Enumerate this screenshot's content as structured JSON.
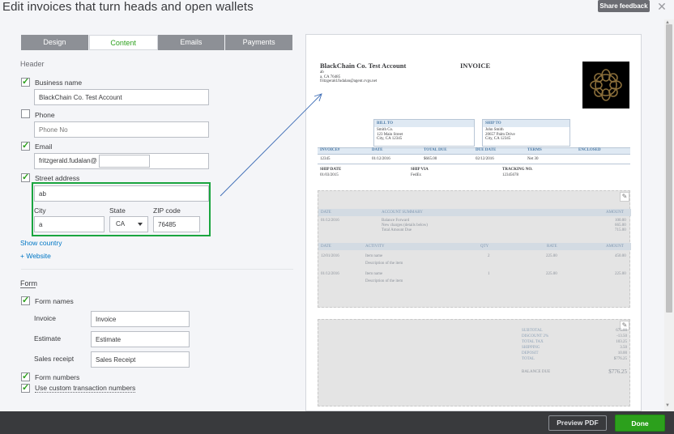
{
  "window": {
    "title": "Edit invoices that turn heads and open wallets",
    "feedback_label": "Share feedback",
    "close_glyph": "✕"
  },
  "tabs": [
    {
      "label": "Design",
      "active": false
    },
    {
      "label": "Content",
      "active": true
    },
    {
      "label": "Emails",
      "active": false
    },
    {
      "label": "Payments",
      "active": false
    }
  ],
  "header_section": {
    "title": "Header",
    "business_name": {
      "label": "Business name",
      "checked": true,
      "value": "BlackChain Co. Test Account"
    },
    "phone": {
      "label": "Phone",
      "checked": false,
      "placeholder": "Phone No"
    },
    "email": {
      "label": "Email",
      "checked": true,
      "value": "fritzgerald.fudalan@"
    },
    "street_address": {
      "label": "Street address",
      "checked": true,
      "value": "ab"
    },
    "city": {
      "label": "City",
      "value": "a"
    },
    "state": {
      "label": "State",
      "value": "CA"
    },
    "zip": {
      "label": "ZIP code",
      "value": "76485"
    },
    "show_country": "Show country",
    "website": "+ Website"
  },
  "form_section": {
    "title": "Form",
    "form_names": {
      "label": "Form names",
      "checked": true
    },
    "invoice": {
      "label": "Invoice",
      "value": "Invoice"
    },
    "estimate": {
      "label": "Estimate",
      "value": "Estimate"
    },
    "sales_receipt": {
      "label": "Sales receipt",
      "value": "Sales Receipt"
    },
    "form_numbers": {
      "label": "Form numbers",
      "checked": true
    },
    "custom_numbers": {
      "label": "Use custom transaction numbers",
      "checked": true
    }
  },
  "preview": {
    "company": "BlackChain Co. Test Account",
    "addr_lines": [
      "ab",
      "a, CA 76485",
      "fritzgerald.fudalan@agent.cvgs.net"
    ],
    "doc_title": "INVOICE",
    "bill_to": {
      "title": "BILL TO",
      "lines": [
        "Smith Co.",
        "123 Main Street",
        "City, CA 12345"
      ]
    },
    "ship_to": {
      "title": "SHIP TO",
      "lines": [
        "John Smith",
        "20657 Palm Drive",
        "City, CA 12345"
      ]
    },
    "info_headers": [
      "INVOICE#",
      "DATE",
      "TOTAL DUE",
      "DUE DATE",
      "TERMS",
      "ENCLOSED"
    ],
    "info_values": [
      "12345",
      "01/12/2016",
      "$665.00",
      "02/12/2016",
      "Net 30",
      ""
    ],
    "ship_headers": [
      "SHIP DATE",
      "SHIP VIA",
      "TRACKING NO."
    ],
    "ship_values": [
      "01/03/2015",
      "FedEx",
      "12345678"
    ],
    "acct_headers": [
      "DATE",
      "ACCOUNT SUMMARY",
      "AMOUNT"
    ],
    "acct_date": "01/12/2016",
    "acct_lines": [
      "Balance Forward",
      "New charges (details below)",
      "Total Amount Due"
    ],
    "acct_amounts": [
      "100.00",
      "665.00",
      "715.00"
    ],
    "item_headers": [
      "DATE",
      "ACTIVITY",
      "QTY",
      "RATE",
      "AMOUNT"
    ],
    "items": [
      {
        "date": "12/01/2016",
        "name": "Item name",
        "desc": "Description of the item",
        "qty": "2",
        "rate": "225.00",
        "amount": "450.00"
      },
      {
        "date": "01/12/2016",
        "name": "Item name",
        "desc": "Description of the item",
        "qty": "1",
        "rate": "225.00",
        "amount": "225.00"
      }
    ],
    "totals": [
      {
        "label": "SUBTOTAL",
        "value": "675.00"
      },
      {
        "label": "DISCOUNT 2%",
        "value": "-13.50"
      },
      {
        "label": "TOTAL TAX",
        "value": "103.25"
      },
      {
        "label": "SHIPPING",
        "value": "3.50"
      },
      {
        "label": "DEPOSIT",
        "value": "10.00"
      },
      {
        "label": "TOTAL",
        "value": "$776.25"
      }
    ],
    "balance_due_label": "BALANCE DUE",
    "balance_due_value": "$776.25"
  },
  "footer": {
    "preview_pdf": "Preview PDF",
    "done": "Done"
  },
  "colors": {
    "accent": "#2ca01c",
    "link": "#0077c5",
    "highlight": "#1aa53f",
    "footer": "#393a3d"
  }
}
